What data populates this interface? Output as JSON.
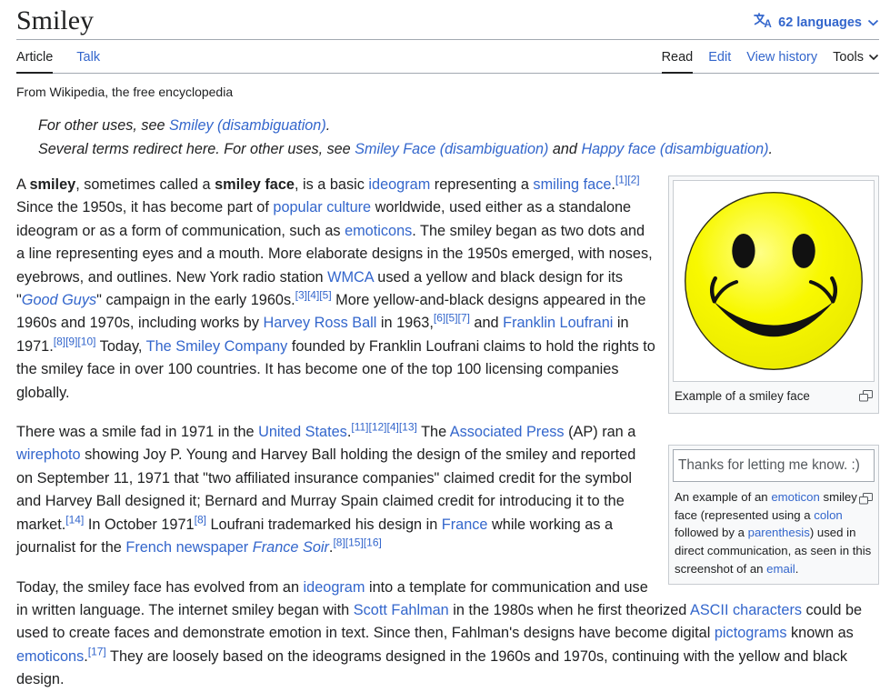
{
  "header": {
    "title": "Smiley",
    "languages_label": "62 languages",
    "subtitle": "From Wikipedia, the free encyclopedia",
    "tabs_left": [
      {
        "label": "Article"
      },
      {
        "label": "Talk"
      }
    ],
    "tabs_right": [
      {
        "label": "Read"
      },
      {
        "label": "Edit"
      },
      {
        "label": "View history"
      },
      {
        "label": "Tools"
      }
    ]
  },
  "icons": {
    "translate-icon": "文A glyph drawn as strokes + letter A",
    "chevron-down-icon": "⌄",
    "magnify-icon": "two overlapping squares (enlarge thumbnail)"
  },
  "colors": {
    "link": "#3366cc",
    "text": "#202122",
    "secondary_text": "#54595d",
    "divider": "#a2a9b1",
    "thumb_border": "#c8ccd1",
    "thumb_background": "#f8f9fa",
    "active_tab_underline": "#202122",
    "smiley_yellow": "#f4f400",
    "smiley_features": "#111111"
  },
  "hatnotes": [
    [
      {
        "s": "p",
        "t": "For other uses, see "
      },
      {
        "s": "a",
        "t": "Smiley (disambiguation)"
      },
      {
        "s": "p",
        "t": "."
      }
    ],
    [
      {
        "s": "p",
        "t": "Several terms redirect here. For other uses, see "
      },
      {
        "s": "a",
        "t": "Smiley Face (disambiguation)"
      },
      {
        "s": "p",
        "t": " and "
      },
      {
        "s": "a",
        "t": "Happy face (disambiguation)"
      },
      {
        "s": "p",
        "t": "."
      }
    ]
  ],
  "paragraphs": [
    [
      {
        "s": "p",
        "t": "A "
      },
      {
        "s": "b",
        "t": "smiley"
      },
      {
        "s": "p",
        "t": ", sometimes called a "
      },
      {
        "s": "b",
        "t": "smiley face"
      },
      {
        "s": "p",
        "t": ", is a basic "
      },
      {
        "s": "a",
        "t": "ideogram"
      },
      {
        "s": "p",
        "t": " representing a "
      },
      {
        "s": "a",
        "t": "smiling face"
      },
      {
        "s": "p",
        "t": "."
      },
      {
        "s": "r",
        "t": "[1][2]"
      },
      {
        "s": "p",
        "t": " Since the 1950s, it has become part of "
      },
      {
        "s": "a",
        "t": "popular culture"
      },
      {
        "s": "p",
        "t": " worldwide, used either as a standalone ideogram or as a form of communication, such as "
      },
      {
        "s": "a",
        "t": "emoticons"
      },
      {
        "s": "p",
        "t": ". The smiley began as two dots and a line representing eyes and a mouth. More elaborate designs in the 1950s emerged, with noses, eyebrows, and outlines. New York radio station "
      },
      {
        "s": "a",
        "t": "WMCA"
      },
      {
        "s": "p",
        "t": " used a yellow and black design for its \""
      },
      {
        "s": "ai",
        "t": "Good Guys"
      },
      {
        "s": "p",
        "t": "\" campaign in the early 1960s."
      },
      {
        "s": "r",
        "t": "[3][4][5]"
      },
      {
        "s": "p",
        "t": " More yellow-and-black designs appeared in the 1960s and 1970s, including works by "
      },
      {
        "s": "a",
        "t": "Harvey Ross Ball"
      },
      {
        "s": "p",
        "t": " in 1963,"
      },
      {
        "s": "r",
        "t": "[6][5][7]"
      },
      {
        "s": "p",
        "t": " and "
      },
      {
        "s": "a",
        "t": "Franklin Loufrani"
      },
      {
        "s": "p",
        "t": " in 1971."
      },
      {
        "s": "r",
        "t": "[8][9][10]"
      },
      {
        "s": "p",
        "t": " Today, "
      },
      {
        "s": "a",
        "t": "The Smiley Company"
      },
      {
        "s": "p",
        "t": " founded by Franklin Loufrani claims to hold the rights to the smiley face in over 100 countries. It has become one of the top 100 licensing companies globally."
      }
    ],
    [
      {
        "s": "p",
        "t": "There was a smile fad in 1971 in the "
      },
      {
        "s": "a",
        "t": "United States"
      },
      {
        "s": "p",
        "t": "."
      },
      {
        "s": "r",
        "t": "[11][12][4][13]"
      },
      {
        "s": "p",
        "t": " The "
      },
      {
        "s": "a",
        "t": "Associated Press"
      },
      {
        "s": "p",
        "t": " (AP) ran a "
      },
      {
        "s": "a",
        "t": "wirephoto"
      },
      {
        "s": "p",
        "t": " showing Joy P. Young and Harvey Ball holding the design of the smiley and reported on September 11, 1971 that \"two affiliated insurance companies\" claimed credit for the symbol and Harvey Ball designed it; Bernard and Murray Spain claimed credit for introducing it to the market."
      },
      {
        "s": "r",
        "t": "[14]"
      },
      {
        "s": "p",
        "t": " In October 1971"
      },
      {
        "s": "r",
        "t": "[8]"
      },
      {
        "s": "p",
        "t": " Loufrani trademarked his design in "
      },
      {
        "s": "a",
        "t": "France"
      },
      {
        "s": "p",
        "t": " while working as a journalist for the "
      },
      {
        "s": "a",
        "t": "French newspaper"
      },
      {
        "s": "p",
        "t": " "
      },
      {
        "s": "ai",
        "t": "France Soir"
      },
      {
        "s": "p",
        "t": "."
      },
      {
        "s": "r",
        "t": "[8][15][16]"
      }
    ],
    [
      {
        "s": "p",
        "t": "Today, the smiley face has evolved from an "
      },
      {
        "s": "a",
        "t": "ideogram"
      },
      {
        "s": "p",
        "t": " into a template for communication and use in written language. The internet smiley began with "
      },
      {
        "s": "a",
        "t": "Scott Fahlman"
      },
      {
        "s": "p",
        "t": " in the 1980s when he first theorized "
      },
      {
        "s": "a",
        "t": "ASCII characters"
      },
      {
        "s": "p",
        "t": " could be used to create faces and demonstrate emotion in text. Since then, Fahlman's designs have become digital "
      },
      {
        "s": "a",
        "t": "pictograms"
      },
      {
        "s": "p",
        "t": " known as "
      },
      {
        "s": "a",
        "t": "emoticons"
      },
      {
        "s": "p",
        "t": "."
      },
      {
        "s": "r",
        "t": "[17]"
      },
      {
        "s": "p",
        "t": " They are loosely based on the ideograms designed in the 1960s and 1970s, continuing with the yellow and black design."
      }
    ]
  ],
  "infobox1": {
    "caption": "Example of a smiley face"
  },
  "infobox2": {
    "email_text": "Thanks for letting me know. :)",
    "caption_segments": [
      {
        "s": "p",
        "t": "An example of an "
      },
      {
        "s": "a",
        "t": "emoticon"
      },
      {
        "s": "p",
        "t": " smiley face (represented using a "
      },
      {
        "s": "a",
        "t": "colon"
      },
      {
        "s": "p",
        "t": " followed by a "
      },
      {
        "s": "a",
        "t": "parenthesis"
      },
      {
        "s": "p",
        "t": ") used in direct communication, as seen in this screenshot of an "
      },
      {
        "s": "a",
        "t": "email"
      },
      {
        "s": "p",
        "t": "."
      }
    ]
  }
}
